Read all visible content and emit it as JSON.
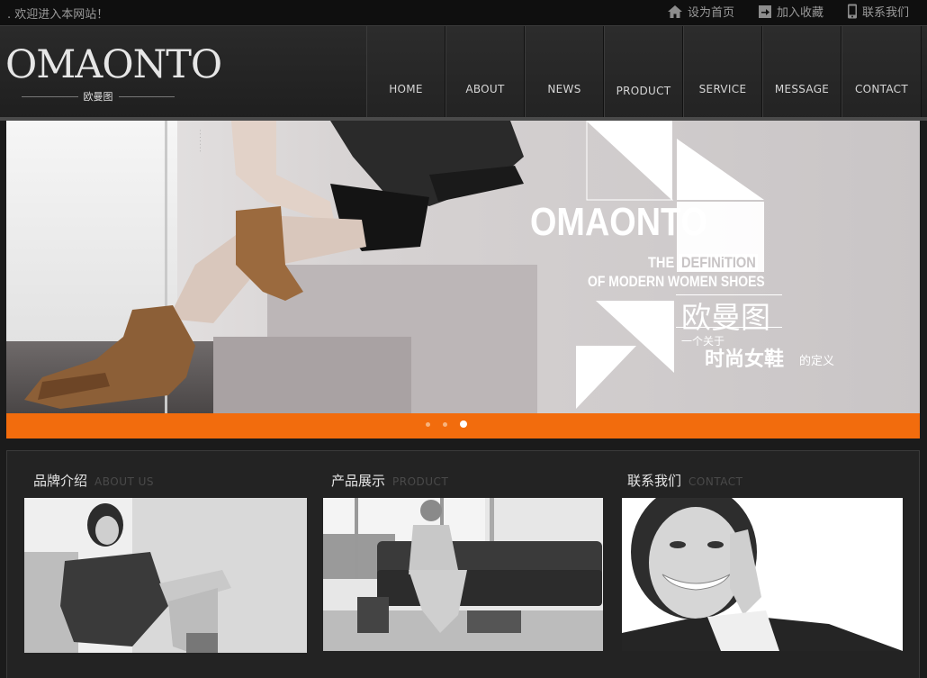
{
  "topbar": {
    "welcome": ". 欢迎进入本网站！",
    "links": [
      {
        "label": "设为首页",
        "icon": "home-icon"
      },
      {
        "label": "加入收藏",
        "icon": "bookmark-icon"
      },
      {
        "label": "联系我们",
        "icon": "phone-icon"
      }
    ]
  },
  "header": {
    "logo": {
      "word": "OMAONTO",
      "sub": "欧曼图"
    },
    "nav": [
      "HOME",
      "ABOUT",
      "NEWS",
      "PRODUCT",
      "SERVICE",
      "MESSAGE",
      "CONTACT"
    ]
  },
  "banner": {
    "brand": "OMAONTO",
    "the": "THE",
    "definition": "DEFINiTION",
    "subtitle": "OF MODERN WOMEN SHOES",
    "cn_name": "欧曼图",
    "cn_small": "一个关于",
    "cn_big": "时尚女鞋",
    "cn_def": "的定义",
    "slide_count": 3,
    "active_slide": 3,
    "accent": "#f26c0d"
  },
  "sections": [
    {
      "title_cn": "品牌介绍",
      "title_en": "ABOUT US"
    },
    {
      "title_cn": "产品展示",
      "title_en": "PRODUCT"
    },
    {
      "title_cn": "联系我们",
      "title_en": "CONTACT"
    }
  ]
}
